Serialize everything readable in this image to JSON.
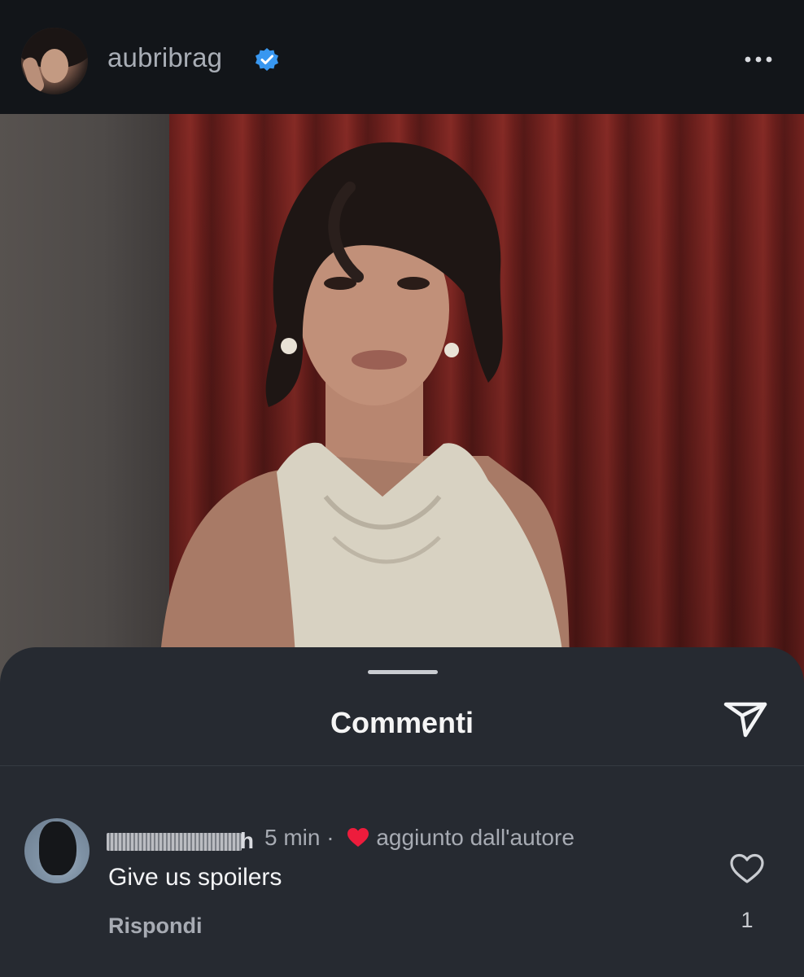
{
  "header": {
    "username": "aubribrag",
    "verified": true,
    "more_icon": "more-horizontal-icon"
  },
  "comments_sheet": {
    "title": "Commenti",
    "share_icon": "send-icon",
    "comments": [
      {
        "username": "fatimaagalish",
        "username_redacted": true,
        "username_visible_suffix": "h",
        "time": "5 min",
        "separator": "·",
        "badge": "aggiunto dall'autore",
        "text": "Give us spoilers",
        "reply_label": "Rispondi",
        "like_count": "1",
        "like_icon": "heart-outline-icon"
      }
    ]
  },
  "colors": {
    "background": "#0f1114",
    "sheet": "#262a31",
    "verified_blue": "#3897f0",
    "heart_red": "#ed1c3c",
    "curtain_red": "#7d2622"
  }
}
